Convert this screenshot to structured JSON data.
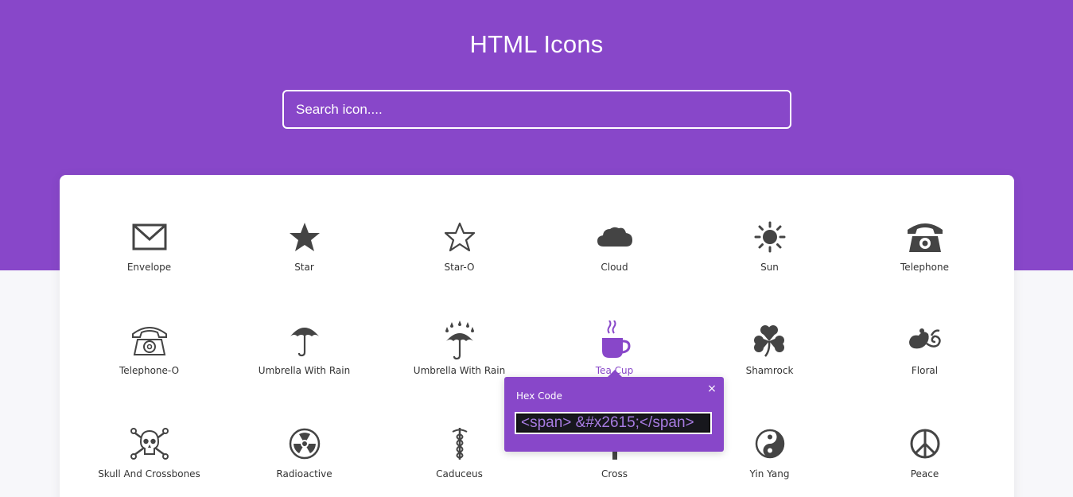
{
  "header": {
    "title": "HTML Icons",
    "search_placeholder": "Search icon...."
  },
  "colors": {
    "accent": "#8847c9",
    "icon": "#444444",
    "background": "#f7f7fa"
  },
  "icons": [
    {
      "label": "Envelope",
      "icon": "envelope-icon"
    },
    {
      "label": "Star",
      "icon": "star-icon"
    },
    {
      "label": "Star-O",
      "icon": "star-outline-icon"
    },
    {
      "label": "Cloud",
      "icon": "cloud-icon"
    },
    {
      "label": "Sun",
      "icon": "sun-icon"
    },
    {
      "label": "Telephone",
      "icon": "telephone-icon"
    },
    {
      "label": "Telephone-O",
      "icon": "telephone-outline-icon"
    },
    {
      "label": "Umbrella With Rain",
      "icon": "umbrella-icon"
    },
    {
      "label": "Umbrella With Rain",
      "icon": "umbrella-rain-icon"
    },
    {
      "label": "Tea Cup",
      "icon": "tea-cup-icon"
    },
    {
      "label": "Shamrock",
      "icon": "shamrock-icon"
    },
    {
      "label": "Floral",
      "icon": "floral-icon"
    },
    {
      "label": "Skull And Crossbones",
      "icon": "skull-crossbones-icon"
    },
    {
      "label": "Radioactive",
      "icon": "radioactive-icon"
    },
    {
      "label": "Caduceus",
      "icon": "caduceus-icon"
    },
    {
      "label": "Cross",
      "icon": "cross-icon"
    },
    {
      "label": "Yin Yang",
      "icon": "yin-yang-icon"
    },
    {
      "label": "Peace",
      "icon": "peace-icon"
    }
  ],
  "popover": {
    "title": "Hex Code",
    "close": "×",
    "code": "<span> &#x2615;</span>"
  }
}
